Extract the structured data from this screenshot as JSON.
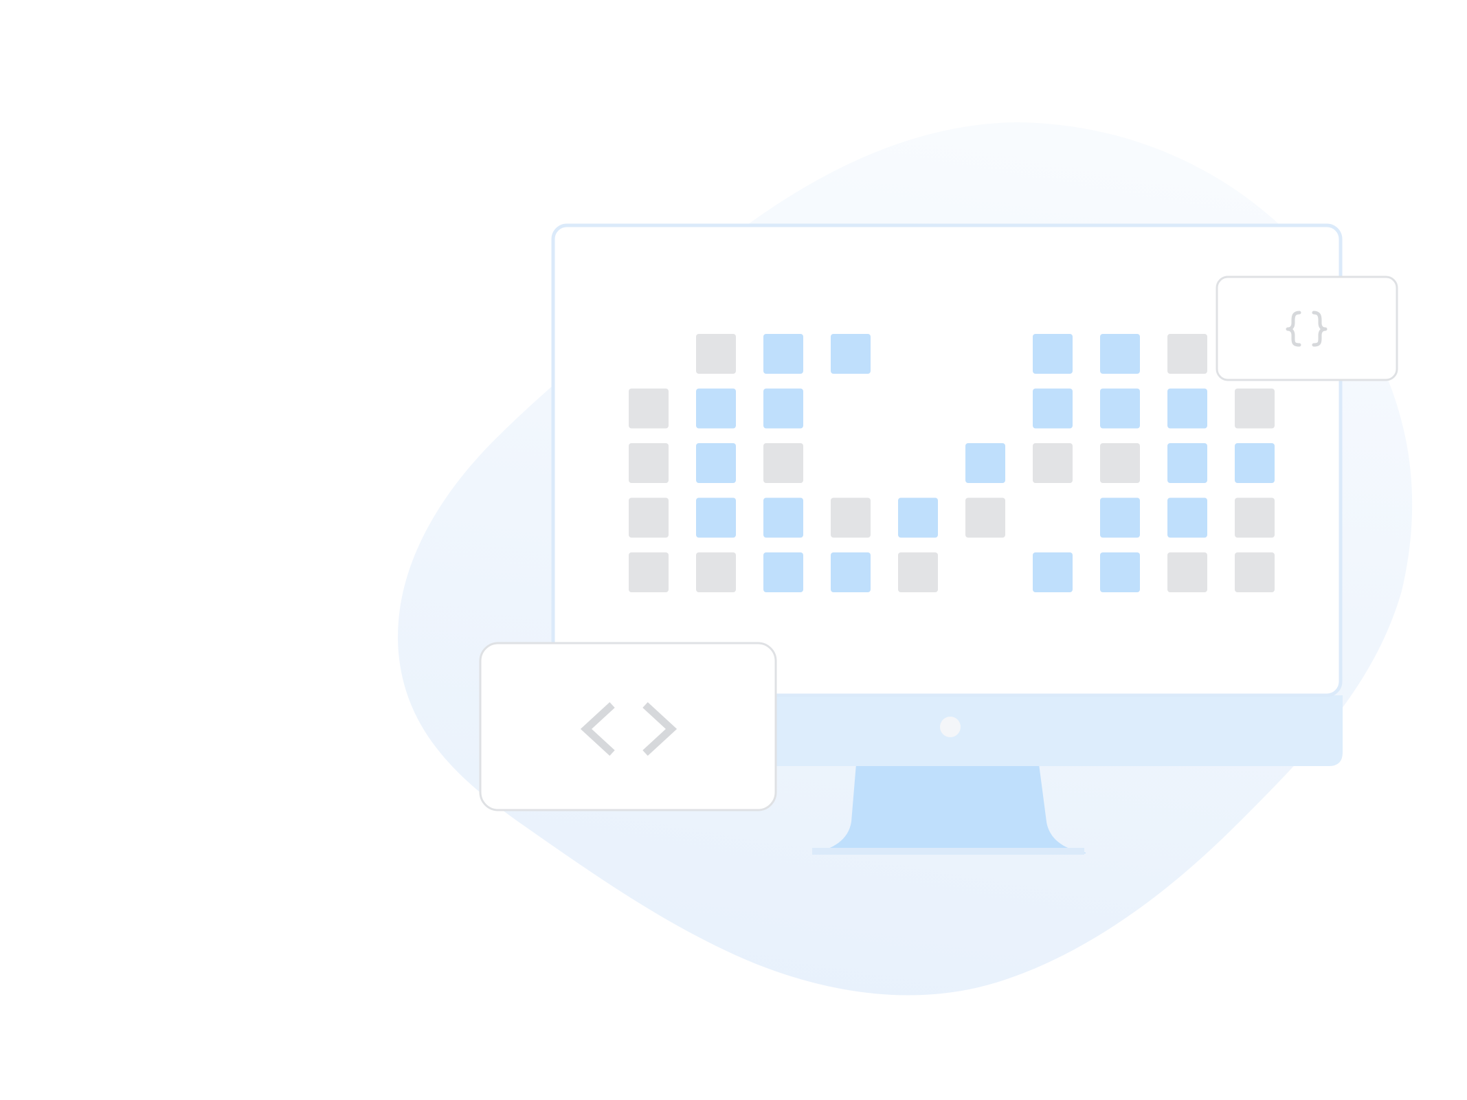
{
  "colors": {
    "background": "#ffffff",
    "blob_top": "#f8fbfe",
    "blob_bottom": "#e8f1fc",
    "monitor_frame": "#dbeafa",
    "screen": "#ffffff",
    "monitor_chin": "#ddedfc",
    "stand": "#bfdffc",
    "power_dot": "#f4f6f9",
    "cell_blue": "#bfdffc",
    "cell_gray": "#e2e3e5",
    "card_fill": "#ffffff",
    "card_stroke": "#dfe1e4",
    "glyph": "#d6d8db"
  },
  "icons": {
    "braces_card": "curly-braces-icon",
    "code_card": "angle-brackets-icon"
  },
  "grid": {
    "rows": [
      [
        "empty",
        "gray",
        "blue",
        "blue",
        "empty",
        "empty",
        "blue",
        "blue",
        "gray",
        "empty"
      ],
      [
        "gray",
        "blue",
        "blue",
        "empty",
        "empty",
        "empty",
        "blue",
        "blue",
        "blue",
        "gray"
      ],
      [
        "gray",
        "blue",
        "gray",
        "empty",
        "empty",
        "blue",
        "gray",
        "gray",
        "blue",
        "blue"
      ],
      [
        "gray",
        "blue",
        "blue",
        "gray",
        "blue",
        "gray",
        "empty",
        "blue",
        "blue",
        "gray"
      ],
      [
        "gray",
        "gray",
        "blue",
        "blue",
        "gray",
        "empty",
        "blue",
        "blue",
        "gray",
        "gray"
      ]
    ]
  }
}
